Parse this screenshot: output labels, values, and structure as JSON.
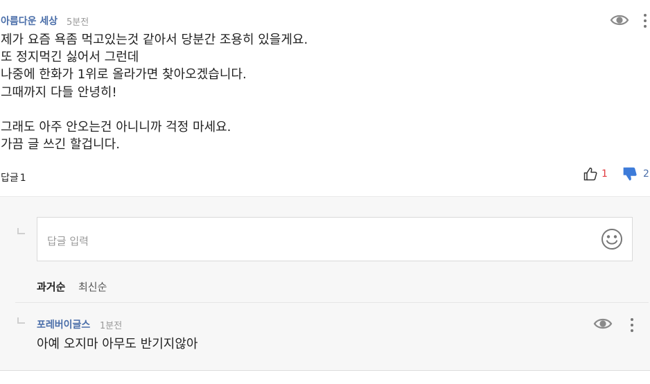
{
  "comment": {
    "author": "아름다운 세상",
    "time": "5분전",
    "lines": [
      "제가 요즘 욕좀 먹고있는것 같아서 당분간 조용히 있을게요.",
      "또 정지먹긴 싫어서 그런데",
      "나중에 한화가 1위로 올라가면 찾아오겠습니다.",
      "그때까지 다들 안녕히!",
      "",
      "그래도 아주 안오는건 아니니까 걱정 마세요.",
      "가끔 글 쓰긴 할겁니다."
    ],
    "reply_label": "답글",
    "reply_count": "1",
    "likes": "1",
    "dislikes": "2"
  },
  "reply_input": {
    "placeholder": "답글 입력"
  },
  "sort": {
    "oldest": "과거순",
    "newest": "최신순"
  },
  "reply": {
    "author": "포레버이글스",
    "time": "1분전",
    "text": "아예 오지마 아무도 반기지않아"
  },
  "colors": {
    "author": "#4a6ea9",
    "like": "#e0393e",
    "dislike": "#4a6ea9",
    "reply_bg": "#f7f7f7"
  },
  "icons": [
    "eye-icon",
    "more-vertical-icon",
    "thumbs-up-icon",
    "thumbs-down-icon",
    "smiley-icon",
    "reply-corner-icon"
  ]
}
